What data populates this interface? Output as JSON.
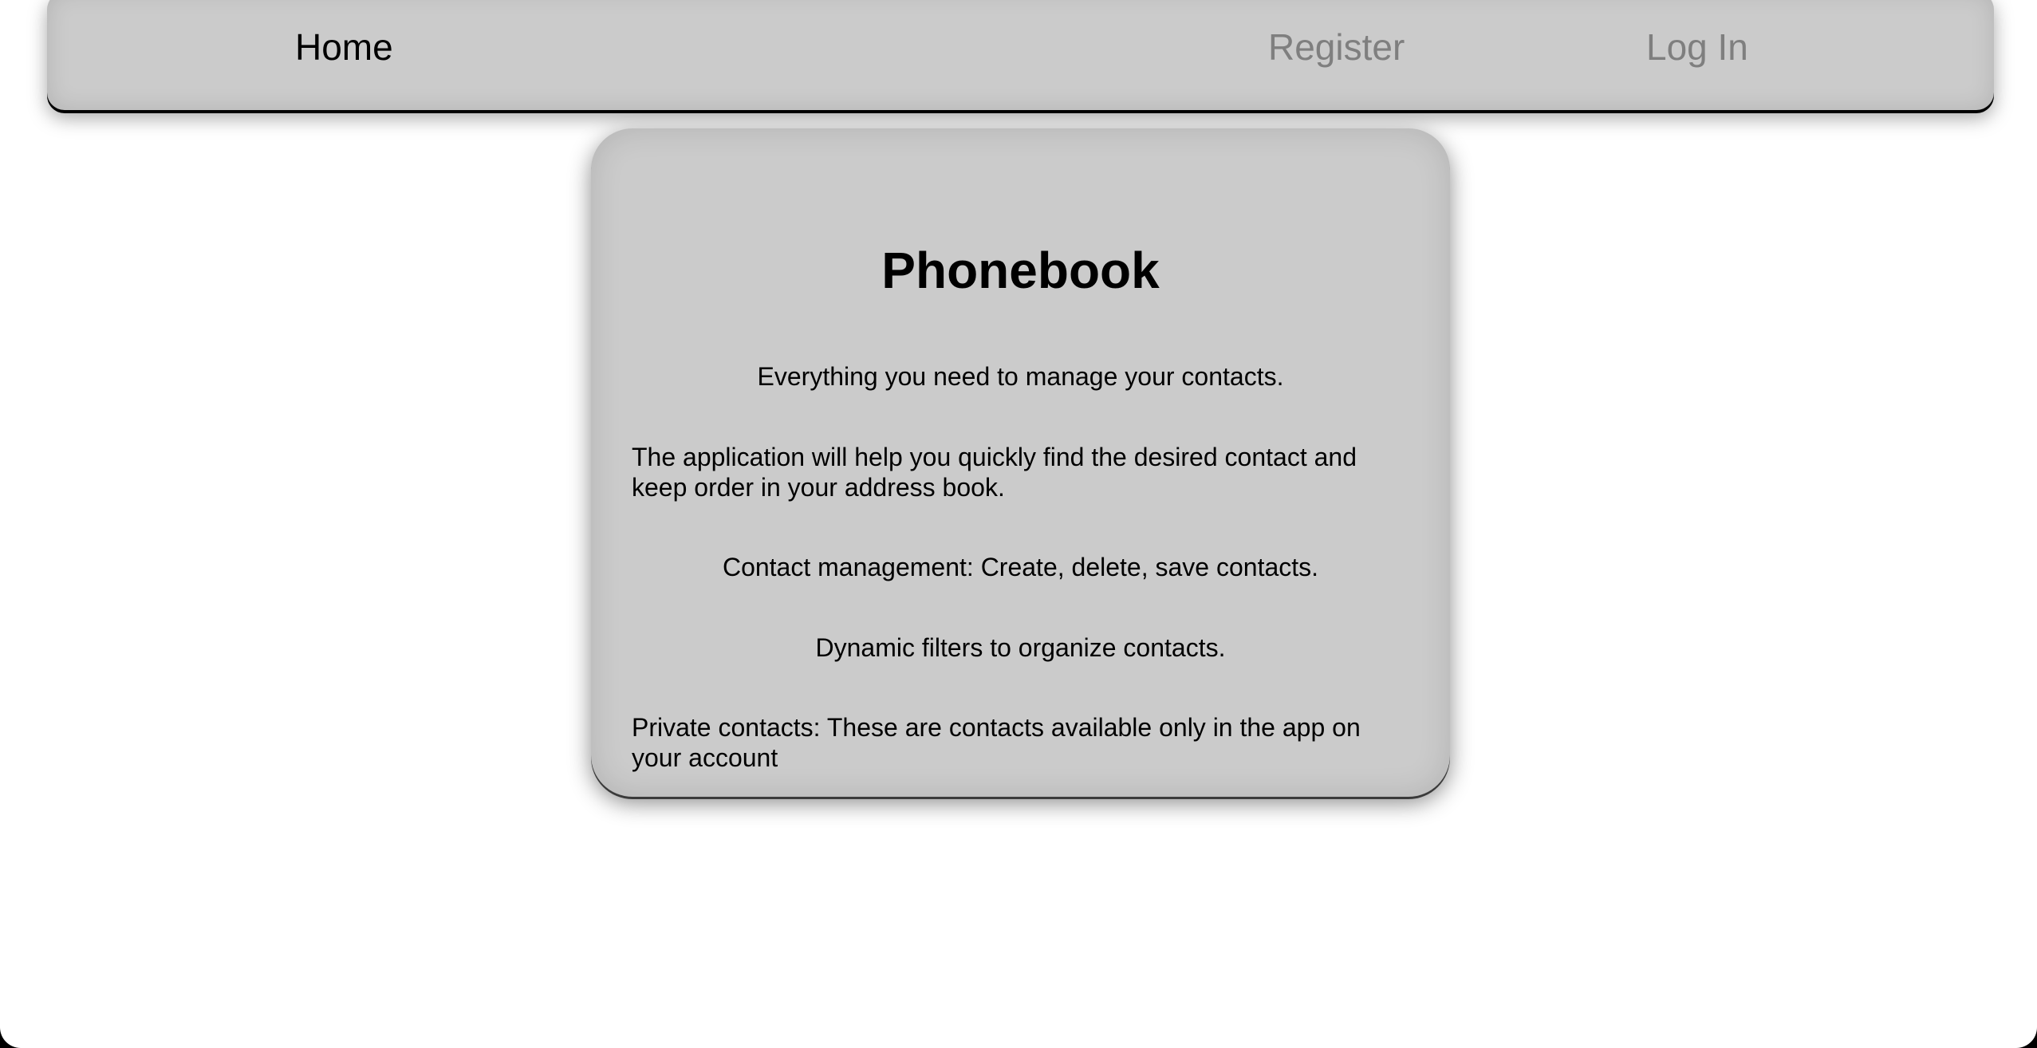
{
  "nav": {
    "home": "Home",
    "register": "Register",
    "login": "Log In"
  },
  "card": {
    "title": "Phonebook",
    "tagline": "Everything you need to manage your contacts.",
    "description": "The application will help you quickly find the desired contact and keep order in your address book.",
    "feature_management": "Contact management: Create, delete, save contacts.",
    "feature_filters": "Dynamic filters to organize contacts.",
    "feature_private": "Private contacts: These are contacts available only in the app on your account"
  },
  "colors": {
    "panel": "#cbcbcb",
    "nav_active": "#000000",
    "nav_inactive": "#7f7f7f",
    "page_background": "#ffffff"
  }
}
